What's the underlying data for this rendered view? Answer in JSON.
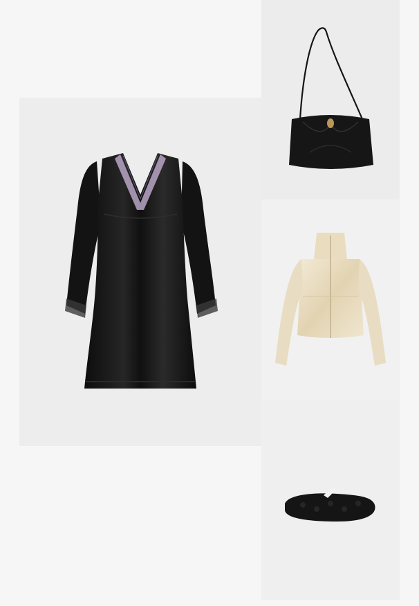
{
  "products": [
    {
      "id": "dress",
      "image": "black-satin-lace-trim-mini-dress-image"
    },
    {
      "id": "bag",
      "image": "black-leather-gathered-shoulder-bag-image"
    },
    {
      "id": "jacket",
      "image": "cream-satin-funnel-neck-jacket-image"
    },
    {
      "id": "shoe",
      "image": "black-shearling-mary-jane-shoe-image"
    }
  ],
  "colors": {
    "page_background": "#f6f6f6",
    "tile_background": "#ececec",
    "dress_satin": "#141414",
    "dress_lace": "#b8a6c6",
    "bag_leather": "#161616",
    "bag_clasp": "#b9975b",
    "jacket_satin": "#eee2c8",
    "shoe_shearling": "#151515"
  }
}
